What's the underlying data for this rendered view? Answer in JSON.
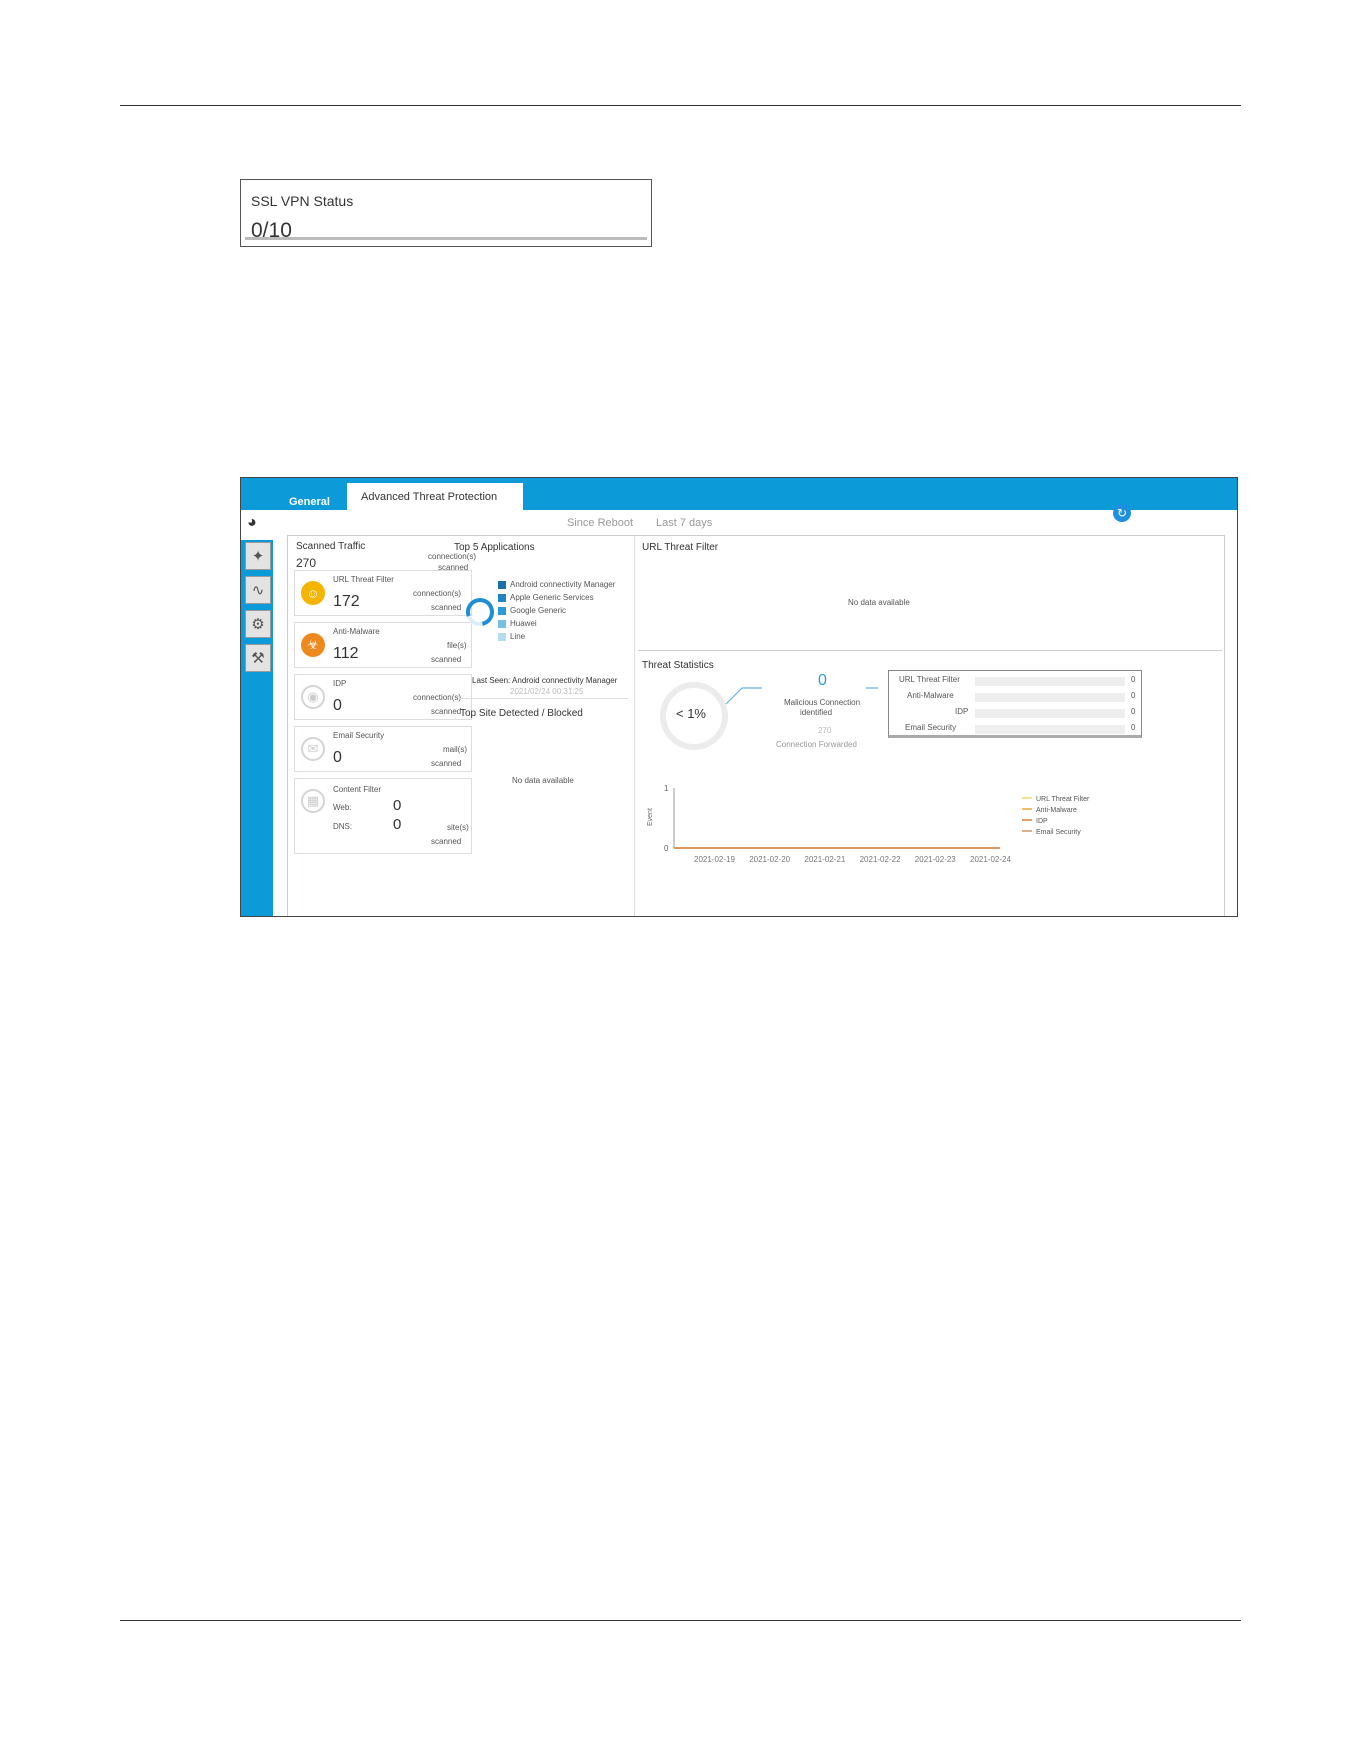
{
  "ssl_vpn": {
    "title": "SSL VPN Status",
    "value": "0/10"
  },
  "tabs": [
    {
      "label": "General"
    },
    {
      "label": "Advanced Threat Protection"
    }
  ],
  "header": {
    "since_reboot": "Since Reboot",
    "last_7_days": "Last 7 days"
  },
  "scanned_traffic": {
    "title": "Scanned Traffic",
    "value": "270",
    "unit": "connection(s)",
    "unit2": "scanned"
  },
  "cards": [
    {
      "title": "URL Threat Filter",
      "value": "172",
      "unit": "connection(s)",
      "unit2": "scanned",
      "color": "#f5b400",
      "icon": "robot-icon"
    },
    {
      "title": "Anti-Malware",
      "value": "112",
      "unit": "file(s)",
      "unit2": "scanned",
      "color": "#ee8a1d",
      "icon": "biohazard-icon"
    },
    {
      "title": "IDP",
      "value": "0",
      "unit": "connection(s)",
      "unit2": "scanned",
      "color": "#cfcfcf",
      "icon": "shield-icon"
    },
    {
      "title": "Email Security",
      "value": "0",
      "unit": "mail(s)",
      "unit2": "scanned",
      "color": "#cfcfcf",
      "icon": "mail-icon"
    }
  ],
  "content_filter": {
    "title": "Content Filter",
    "web_label": "Web:",
    "web_value": "0",
    "dns_label": "DNS:",
    "dns_value": "0",
    "unit": "site(s)",
    "unit2": "scanned"
  },
  "top5": {
    "title": "Top 5 Applications",
    "items": [
      {
        "label": "Android connectivity Manager",
        "color": "#1a6fa8"
      },
      {
        "label": "Apple Generic Services",
        "color": "#1f86c4"
      },
      {
        "label": "Google Generic",
        "color": "#2a9bd8"
      },
      {
        "label": "Huawei",
        "color": "#76c0e8"
      },
      {
        "label": "Line",
        "color": "#b6dcf2"
      }
    ],
    "last_seen": "Last Seen: Android connectivity Manager",
    "last_seen_time": "2021/02/24 00:31:25"
  },
  "top_site": {
    "title": "Top Site Detected / Blocked",
    "empty": "No data available"
  },
  "url_threat_filter": {
    "title": "URL Threat Filter",
    "empty": "No data available"
  },
  "threat_stats": {
    "title": "Threat Statistics",
    "percent": "< 1%",
    "malicious_value": "0",
    "malicious_label": "Malicious Connection",
    "malicious_label2": "identified",
    "forwarded_value": "270",
    "forwarded_label": "Connection Forwarded",
    "rows": [
      {
        "label": "URL Threat Filter",
        "value": "0"
      },
      {
        "label": "Anti-Malware",
        "value": "0"
      },
      {
        "label": "IDP",
        "value": "0"
      },
      {
        "label": "Email Security",
        "value": "0"
      }
    ]
  },
  "chart_data": {
    "type": "line",
    "ylabel": "Event",
    "ylim": [
      0,
      1
    ],
    "yticks": [
      "0",
      "1"
    ],
    "x": [
      "2021-02-19",
      "2021-02-20",
      "2021-02-21",
      "2021-02-22",
      "2021-02-23",
      "2021-02-24"
    ],
    "series": [
      {
        "name": "URL Threat Filter",
        "values": [
          0,
          0,
          0,
          0,
          0,
          0
        ],
        "color": "#f5d56e"
      },
      {
        "name": "Anti-Malware",
        "values": [
          0,
          0,
          0,
          0,
          0,
          0
        ],
        "color": "#f2a63a"
      },
      {
        "name": "IDP",
        "values": [
          0,
          0,
          0,
          0,
          0,
          0
        ],
        "color": "#e07f2a"
      },
      {
        "name": "Email Security",
        "values": [
          0,
          0,
          0,
          0,
          0,
          0
        ],
        "color": "#d8935a"
      }
    ]
  }
}
